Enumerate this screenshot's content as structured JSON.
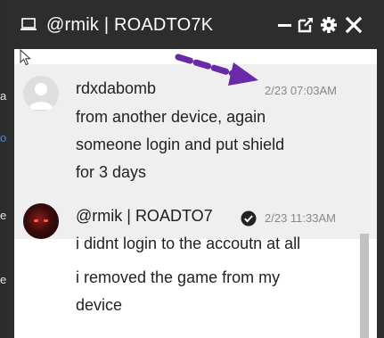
{
  "window": {
    "title": "@rmik | ROADTO7K",
    "controls": [
      "minimize-icon",
      "popout-icon",
      "gear-icon",
      "close-icon"
    ]
  },
  "background_fragments": [
    "a",
    "o",
    "e",
    "e"
  ],
  "messages": [
    {
      "author": "rdxdabomb",
      "time": "2/23 07:03AM",
      "lines": [
        "from another device, again",
        "someone login and put shield",
        "for 3 days"
      ],
      "highlighted": true
    },
    {
      "author": "@rmik | ROADTO7",
      "verified": true,
      "time": "2/23 11:33AM",
      "lines": [
        "i didnt login to the accoutn at all",
        "i removed the game from my",
        "device"
      ]
    }
  ],
  "colors": {
    "titlebar": "#2d2d2d",
    "highlight": "#efefef",
    "annotation_arrow": "#6a2aa8",
    "scrollbar": "#c2c2c2"
  }
}
